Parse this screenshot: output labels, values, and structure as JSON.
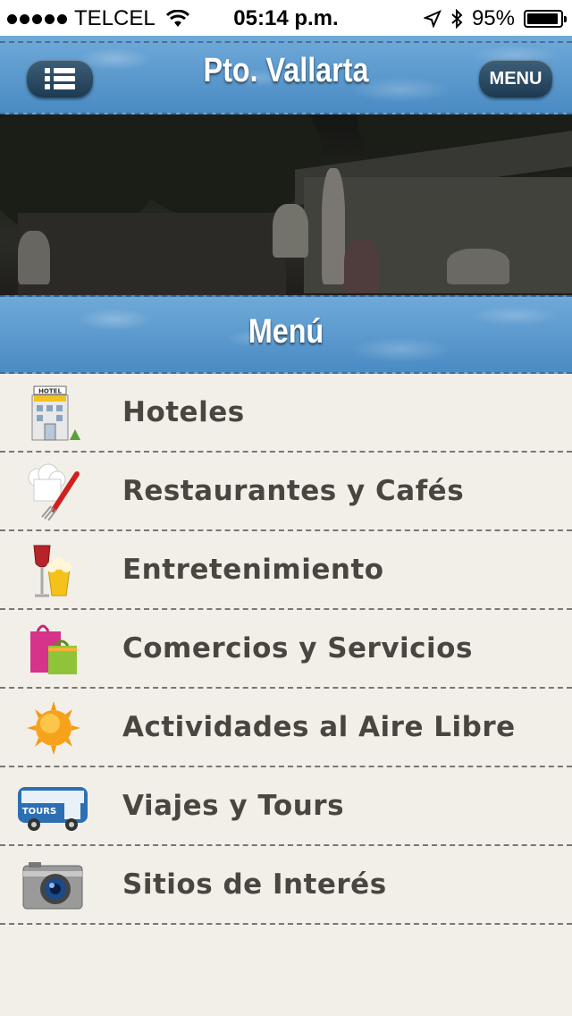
{
  "status_bar": {
    "carrier": "TELCEL",
    "time": "05:14 p.m.",
    "battery": "95%",
    "battery_level": 0.95
  },
  "nav_bar": {
    "title": "Pto. Vallarta",
    "menu_button": "MENU",
    "list_icon": "list-icon"
  },
  "section": {
    "title": "Menú"
  },
  "menu": {
    "items": [
      {
        "label": "Hoteles",
        "icon": "hotel-icon",
        "icon_text": "HOTEL"
      },
      {
        "label": "Restaurantes y Cafés",
        "icon": "chef-hat-fork-icon"
      },
      {
        "label": "Entretenimiento",
        "icon": "wine-popcorn-icon"
      },
      {
        "label": "Comercios y Servicios",
        "icon": "shopping-bags-icon"
      },
      {
        "label": "Actividades al Aire Libre",
        "icon": "sun-icon"
      },
      {
        "label": "Viajes y Tours",
        "icon": "bus-icon",
        "icon_text": "TOURS"
      },
      {
        "label": "Sitios de Interés",
        "icon": "camera-icon"
      }
    ]
  },
  "colors": {
    "header_blue": "#4a8bc4",
    "text_brown": "#4b4540",
    "background": "#f1efe8"
  }
}
